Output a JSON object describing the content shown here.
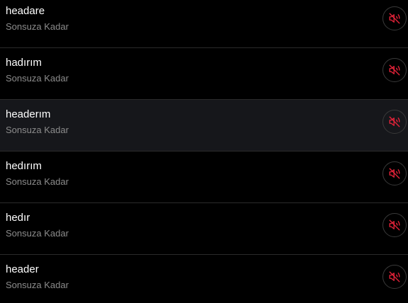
{
  "items": [
    {
      "title": "headare",
      "subtitle": "Sonsuza Kadar",
      "icon": "muted-speaker-icon",
      "highlighted": false
    },
    {
      "title": "hadırım",
      "subtitle": "Sonsuza Kadar",
      "icon": "muted-speaker-icon",
      "highlighted": false
    },
    {
      "title": "headerım",
      "subtitle": "Sonsuza Kadar",
      "icon": "muted-speaker-icon",
      "highlighted": true
    },
    {
      "title": "hedırım",
      "subtitle": "Sonsuza Kadar",
      "icon": "muted-speaker-icon",
      "highlighted": false
    },
    {
      "title": "hedır",
      "subtitle": "Sonsuza Kadar",
      "icon": "muted-speaker-icon",
      "highlighted": false
    },
    {
      "title": "header",
      "subtitle": "Sonsuza Kadar",
      "icon": "muted-speaker-icon",
      "highlighted": false
    }
  ],
  "colors": {
    "background": "#000000",
    "highlight": "#16171b",
    "divider": "#2b2b2b",
    "title": "#ffffff",
    "subtitle": "#8c8c8c",
    "icon_accent": "#e8233a"
  }
}
